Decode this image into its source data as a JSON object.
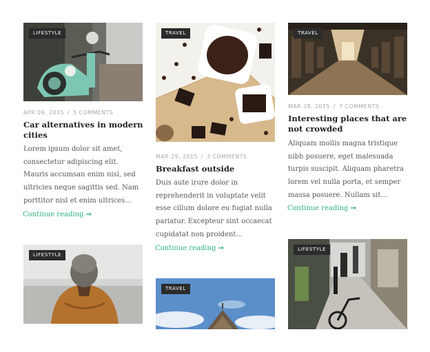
{
  "posts": [
    {
      "category": "LIFESTYLE",
      "date": "APR 09, 2015",
      "comments": "5 COMMENTS",
      "title": "Car alternatives in modern cities",
      "excerpt": "Lorem ipsum dolor sit amet, consectetur adipiscing elit. Mauris accumsan enim nisi, sed ultricies neque sagittis sed. Nam porttitor nisl et enim ultrices...",
      "more": "Continue reading",
      "image": "scooter"
    },
    {
      "category": "TRAVEL",
      "date": "MAR 29, 2015",
      "comments": "3 COMMENTS",
      "title": "Breakfast outside",
      "excerpt": "Duis aute irure dolor in reprehenderit in voluptate velit esse cillum dolore eu fugiat nulla pariatur. Excepteur sint occaecat cupidatat non proident...",
      "more": "Continue reading",
      "image": "coffee"
    },
    {
      "category": "TRAVEL",
      "date": "MAR 28, 2015",
      "comments": "7 COMMENTS",
      "title": "Interesting places that are not crowded",
      "excerpt": "Aliquam mollis magna tristique nibh posuere, eget malesuada turpis suscipit. Aliquam pharetra lorem vel nulla porta, et semper massa posuere. Nullam sit...",
      "more": "Continue reading",
      "image": "train"
    },
    {
      "category": "LIFESTYLE",
      "image": "person-beanie"
    },
    {
      "category": "TRAVEL",
      "image": "sky-hut"
    },
    {
      "category": "LIFESTYLE",
      "image": "street"
    }
  ],
  "arrow_glyph": "→",
  "separator": "/",
  "colors": {
    "accent": "#2cb47b",
    "badge_bg": "#2b2b2b",
    "meta": "#a8a8a8"
  }
}
